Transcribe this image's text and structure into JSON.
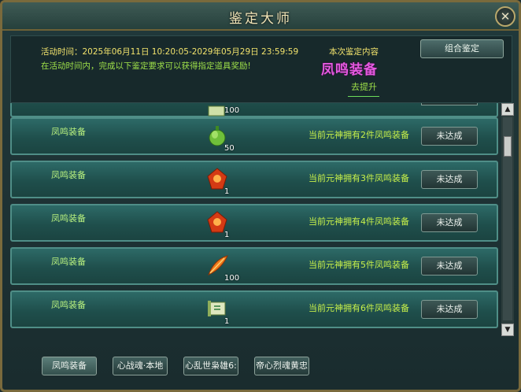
{
  "window": {
    "title": "鉴定大师",
    "close_icon": "close-icon"
  },
  "info": {
    "activity_time": "活动时间：2025年06月11日 10:20:05-2029年05月29日 23:59:59",
    "description": "在活动时间内，完成以下鉴定要求可以获得指定道具奖励!",
    "content_label": "本次鉴定内容",
    "content_name": "凤鸣装备",
    "goto_label": "去提升",
    "combo_button": "组合鉴定"
  },
  "list": {
    "partial_row": {
      "count": "100",
      "item_icon": "scroll-icon"
    },
    "rows": [
      {
        "category": "凤鸣装备",
        "item_icon": "green-gourd-icon",
        "count": "50",
        "requirement": "当前元神拥有2件凤鸣装备",
        "status": "未达成"
      },
      {
        "category": "凤鸣装备",
        "item_icon": "red-gem-icon",
        "count": "1",
        "requirement": "当前元神拥有3件凤鸣装备",
        "status": "未达成"
      },
      {
        "category": "凤鸣装备",
        "item_icon": "red-gem-icon",
        "count": "1",
        "requirement": "当前元神拥有4件凤鸣装备",
        "status": "未达成"
      },
      {
        "category": "凤鸣装备",
        "item_icon": "phoenix-feather-icon",
        "count": "100",
        "requirement": "当前元神拥有5件凤鸣装备",
        "status": "未达成"
      },
      {
        "category": "凤鸣装备",
        "item_icon": "scroll-icon",
        "count": "1",
        "requirement": "当前元神拥有6件凤鸣装备",
        "status": "未达成"
      }
    ]
  },
  "tabs": [
    {
      "label": "凤鸣装备",
      "active": true
    },
    {
      "label": "心战魂·本地",
      "active": false
    },
    {
      "label": "心乱世枭雄6:",
      "active": false
    },
    {
      "label": "帝心烈魂黄忠",
      "active": false
    }
  ],
  "colors": {
    "accent_text": "#9fe14a",
    "title_pink": "#e55ae0",
    "requirement_text": "#c7f04a"
  }
}
